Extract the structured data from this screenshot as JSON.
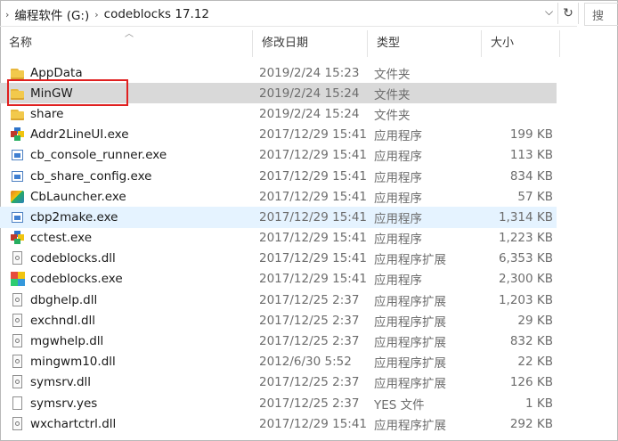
{
  "address": {
    "breadcrumb": [
      "编程软件 (G:)",
      "codeblocks 17.12"
    ],
    "search_placeholder": "搜"
  },
  "columns": {
    "name": "名称",
    "date": "修改日期",
    "type": "类型",
    "size": "大小"
  },
  "rows": [
    {
      "name": "AppData",
      "date": "2019/2/24 15:23",
      "type": "文件夹",
      "size": "",
      "icon": "folder-icon"
    },
    {
      "name": "MinGW",
      "date": "2019/2/24 15:24",
      "type": "文件夹",
      "size": "",
      "icon": "folder-icon",
      "state": "selected"
    },
    {
      "name": "share",
      "date": "2019/2/24 15:24",
      "type": "文件夹",
      "size": "",
      "icon": "folder-icon"
    },
    {
      "name": "Addr2LineUI.exe",
      "date": "2017/12/29 15:41",
      "type": "应用程序",
      "size": "199 KB",
      "icon": "colorful-app-icon"
    },
    {
      "name": "cb_console_runner.exe",
      "date": "2017/12/29 15:41",
      "type": "应用程序",
      "size": "113 KB",
      "icon": "application-icon"
    },
    {
      "name": "cb_share_config.exe",
      "date": "2017/12/29 15:41",
      "type": "应用程序",
      "size": "834 KB",
      "icon": "application-icon"
    },
    {
      "name": "CbLauncher.exe",
      "date": "2017/12/29 15:41",
      "type": "应用程序",
      "size": "57 KB",
      "icon": "launcher-icon"
    },
    {
      "name": "cbp2make.exe",
      "date": "2017/12/29 15:41",
      "type": "应用程序",
      "size": "1,314 KB",
      "icon": "application-icon",
      "state": "hover"
    },
    {
      "name": "cctest.exe",
      "date": "2017/12/29 15:41",
      "type": "应用程序",
      "size": "1,223 KB",
      "icon": "colorful-app-icon"
    },
    {
      "name": "codeblocks.dll",
      "date": "2017/12/29 15:41",
      "type": "应用程序扩展",
      "size": "6,353 KB",
      "icon": "dll-icon"
    },
    {
      "name": "codeblocks.exe",
      "date": "2017/12/29 15:41",
      "type": "应用程序",
      "size": "2,300 KB",
      "icon": "codeblocks-icon"
    },
    {
      "name": "dbghelp.dll",
      "date": "2017/12/25 2:37",
      "type": "应用程序扩展",
      "size": "1,203 KB",
      "icon": "dll-icon"
    },
    {
      "name": "exchndl.dll",
      "date": "2017/12/25 2:37",
      "type": "应用程序扩展",
      "size": "29 KB",
      "icon": "dll-icon"
    },
    {
      "name": "mgwhelp.dll",
      "date": "2017/12/25 2:37",
      "type": "应用程序扩展",
      "size": "832 KB",
      "icon": "dll-icon"
    },
    {
      "name": "mingwm10.dll",
      "date": "2012/6/30 5:52",
      "type": "应用程序扩展",
      "size": "22 KB",
      "icon": "dll-icon"
    },
    {
      "name": "symsrv.dll",
      "date": "2017/12/25 2:37",
      "type": "应用程序扩展",
      "size": "126 KB",
      "icon": "dll-icon"
    },
    {
      "name": "symsrv.yes",
      "date": "2017/12/25 2:37",
      "type": "YES 文件",
      "size": "1 KB",
      "icon": "file-icon"
    },
    {
      "name": "wxchartctrl.dll",
      "date": "2017/12/29 15:41",
      "type": "应用程序扩展",
      "size": "292 KB",
      "icon": "dll-icon"
    }
  ],
  "colors": {
    "selected": "#d9d9d9",
    "hover": "#e5f3ff",
    "annotation": "#e02020"
  }
}
